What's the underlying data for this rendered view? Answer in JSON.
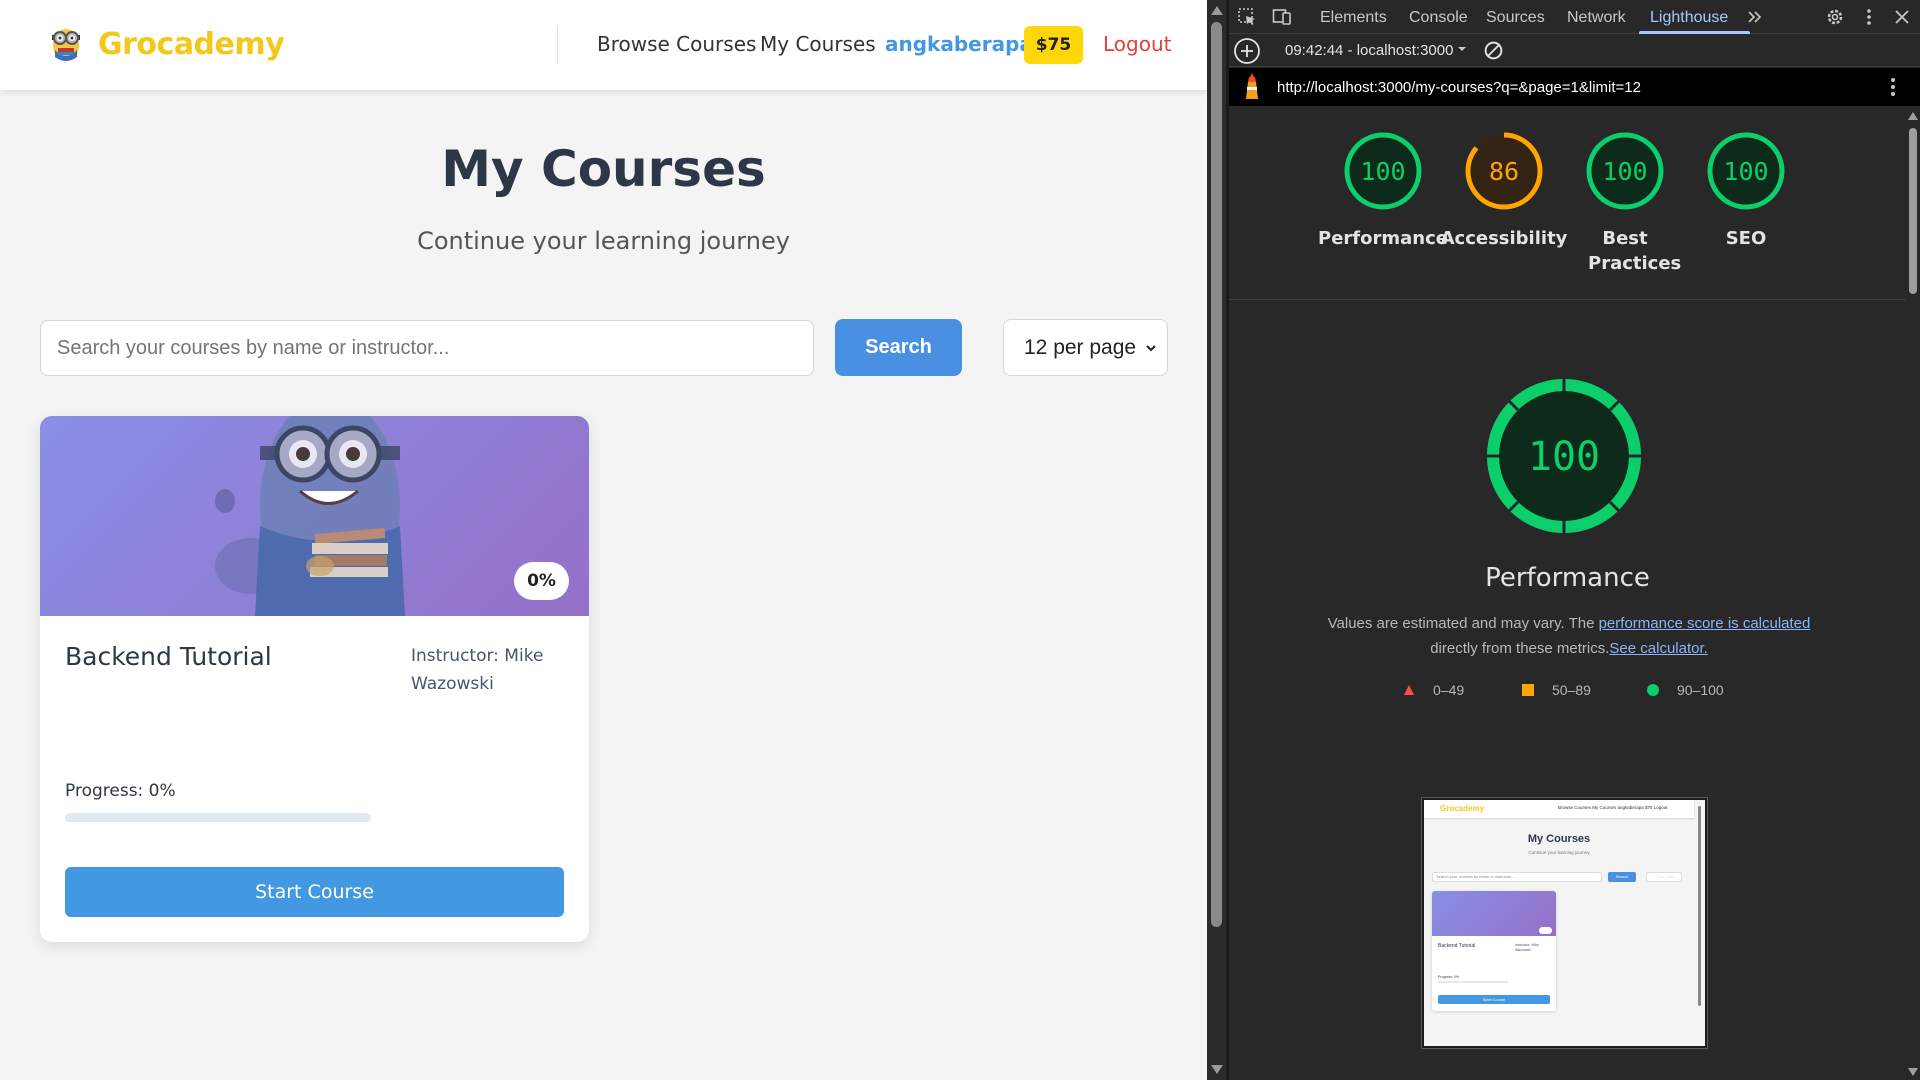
{
  "app": {
    "brand": "Grocademy",
    "nav": {
      "browse": "Browse Courses",
      "my_courses": "My Courses",
      "username": "angkaberapa",
      "balance": "$75",
      "logout": "Logout"
    },
    "page_title": "My Courses",
    "page_subtitle": "Continue your learning journey",
    "search": {
      "placeholder": "Search your courses by name or instructor...",
      "button": "Search"
    },
    "per_page": "12 per page",
    "courses": [
      {
        "title": "Backend Tutorial",
        "instructor": "Instructor: Mike Wazowski",
        "badge": "0%",
        "progress_text": "Progress: 0%",
        "progress": 0,
        "action": "Start Course"
      }
    ]
  },
  "devtools": {
    "tabs": [
      "Elements",
      "Console",
      "Sources",
      "Network",
      "Lighthouse"
    ],
    "active_tab": "Lighthouse",
    "report_time": "09:42:44 - localhost:3000",
    "url": "http://localhost:3000/my-courses?q=&page=1&limit=12",
    "scores": [
      {
        "label": "Performance",
        "value": 100
      },
      {
        "label": "Accessibility",
        "value": 86
      },
      {
        "label": "Best Practices",
        "value": 100
      },
      {
        "label": "SEO",
        "value": 100
      }
    ],
    "detail": {
      "score": "100",
      "title": "Performance",
      "desc_prefix": "Values are estimated and may vary. The ",
      "desc_link": "performance score is calculated",
      "desc_mid": " directly from these metrics.",
      "desc_link2": "See calculator."
    },
    "legend": [
      "0–49",
      "50–89",
      "90–100"
    ],
    "colors": {
      "pass": "#0cce6b",
      "average": "#ffa400",
      "fail": "#ff4e42"
    },
    "thumbnail": {
      "brand": "Grocademy",
      "nav": "Browse Courses   My Courses   angkaberapa   $75   Logout",
      "title": "My Courses",
      "subtitle": "Continue your learning journey",
      "search_placeholder": "Search your courses by name or instructor...",
      "search_button": "Search",
      "per_page": "12 per page",
      "card_title": "Backend Tutorial",
      "card_instructor": "Instructor: Mike Wazowski",
      "card_progress": "Progress: 0%",
      "card_button": "Start Course"
    }
  }
}
